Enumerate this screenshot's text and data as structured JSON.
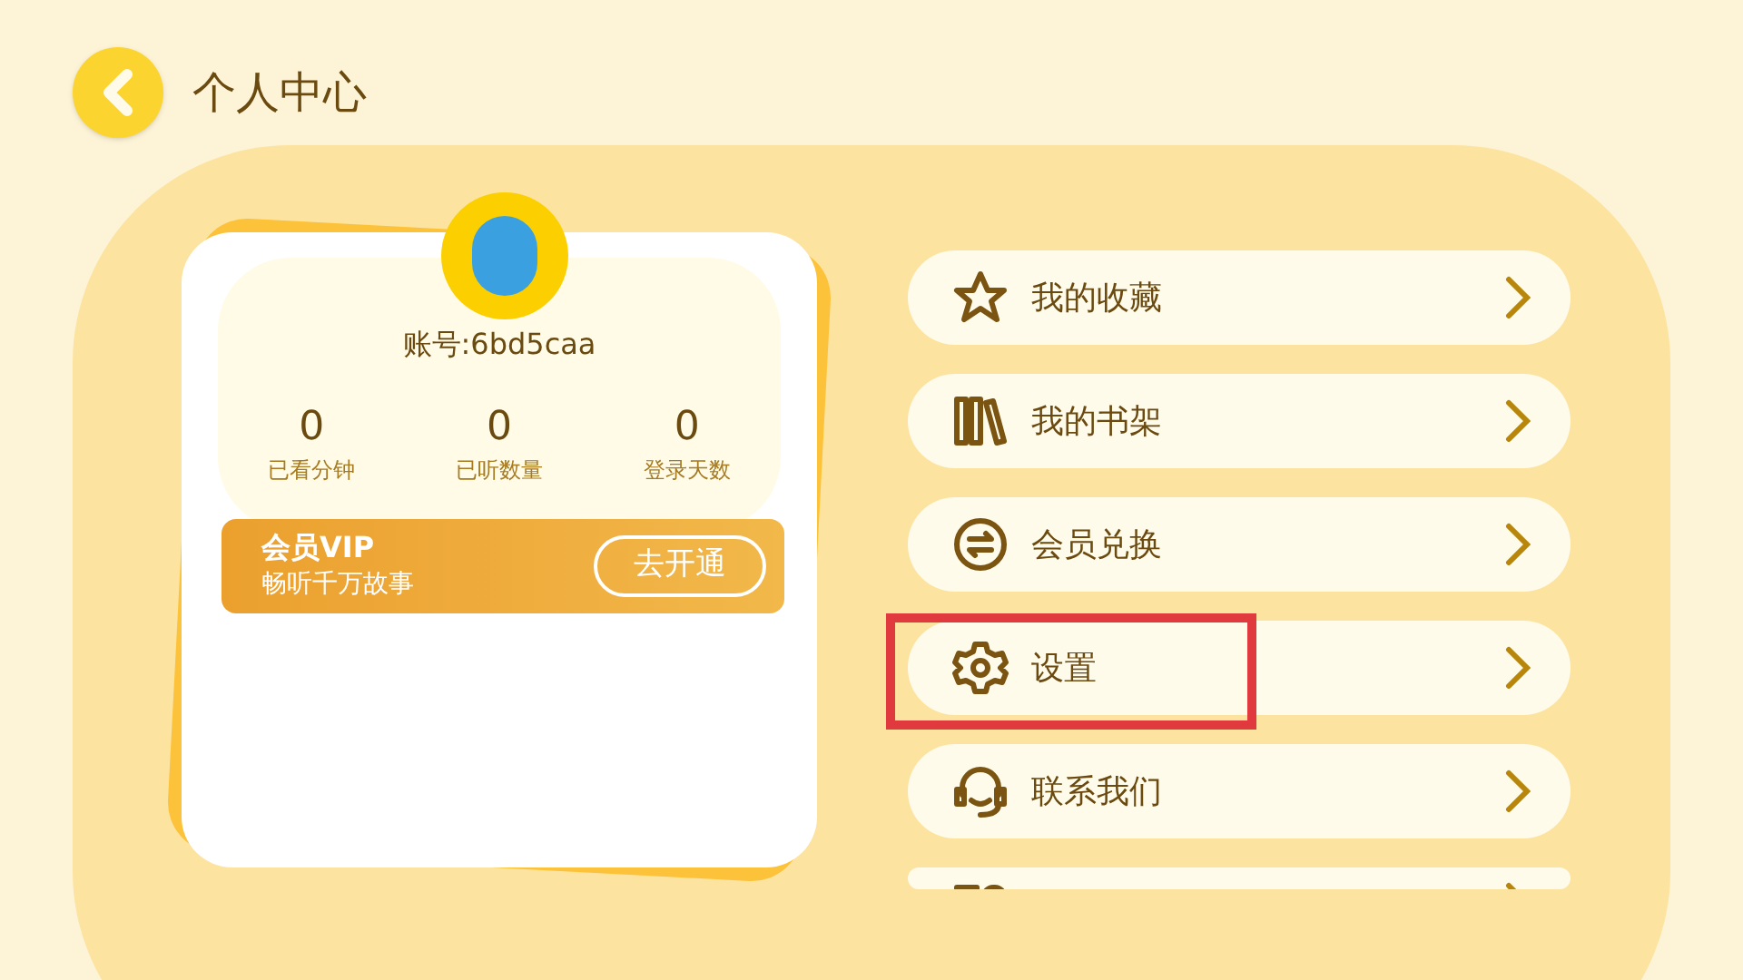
{
  "header": {
    "title": "个人中心"
  },
  "profile": {
    "account": "账号:6bd5caa",
    "stats": [
      {
        "value": "0",
        "label": "已看分钟"
      },
      {
        "value": "0",
        "label": "已听数量"
      },
      {
        "value": "0",
        "label": "登录天数"
      }
    ],
    "vip": {
      "title": "会员VIP",
      "subtitle": "畅听千万故事",
      "button": "去开通"
    }
  },
  "menu": [
    {
      "kind": "star",
      "label": "我的收藏",
      "highlighted": false
    },
    {
      "kind": "books",
      "label": "我的书架",
      "highlighted": false
    },
    {
      "kind": "exchange",
      "label": "会员兑换",
      "highlighted": false
    },
    {
      "kind": "gear",
      "label": "设置",
      "highlighted": true
    },
    {
      "kind": "headset",
      "label": "联系我们",
      "highlighted": false
    },
    {
      "kind": "grid",
      "highlighted": false
    }
  ]
}
